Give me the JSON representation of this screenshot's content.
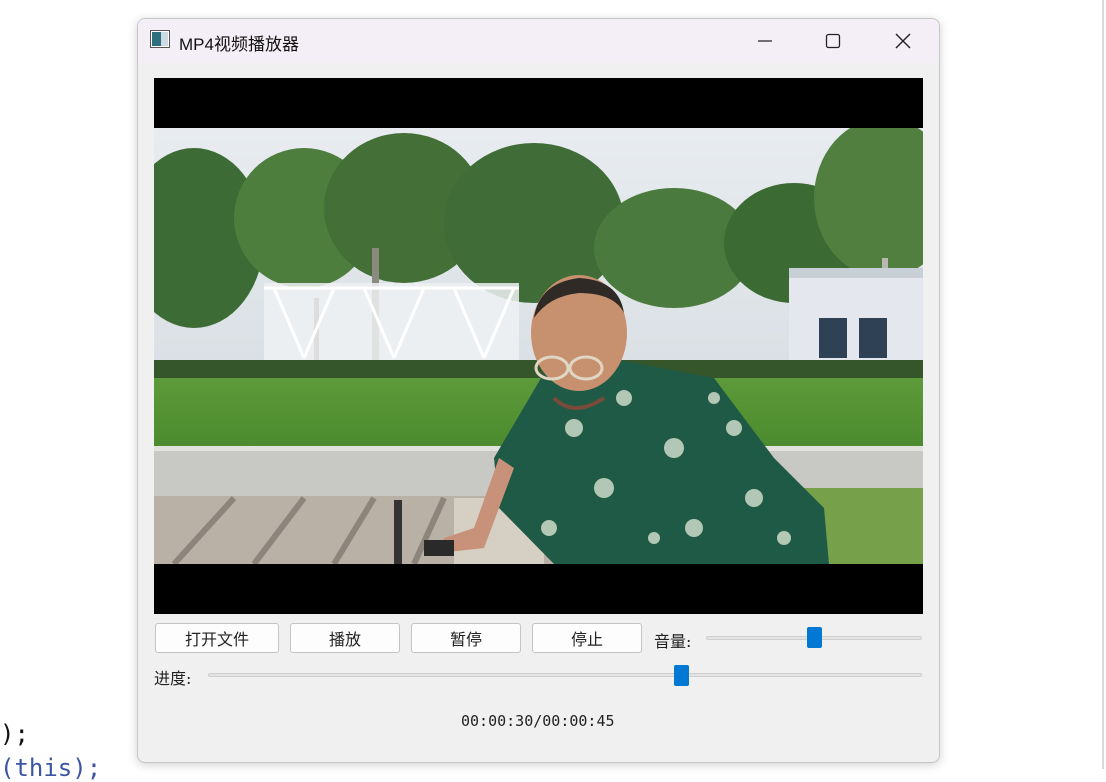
{
  "window": {
    "title": "MP4视频播放器",
    "accent_color": "#0078d4",
    "controls": {
      "minimize_icon": "minimize-icon",
      "maximize_icon": "maximize-icon",
      "close_icon": "close-icon"
    }
  },
  "background": {
    "code_line_1": ");",
    "code_line_2": "(this);"
  },
  "controls": {
    "open_file_label": "打开文件",
    "play_label": "播放",
    "pause_label": "暂停",
    "stop_label": "停止",
    "volume_label": "音量:",
    "volume_level": 0.5,
    "progress_label": "进度:",
    "progress_fraction": 0.667,
    "time_display": "00:00:30/00:00:45"
  }
}
